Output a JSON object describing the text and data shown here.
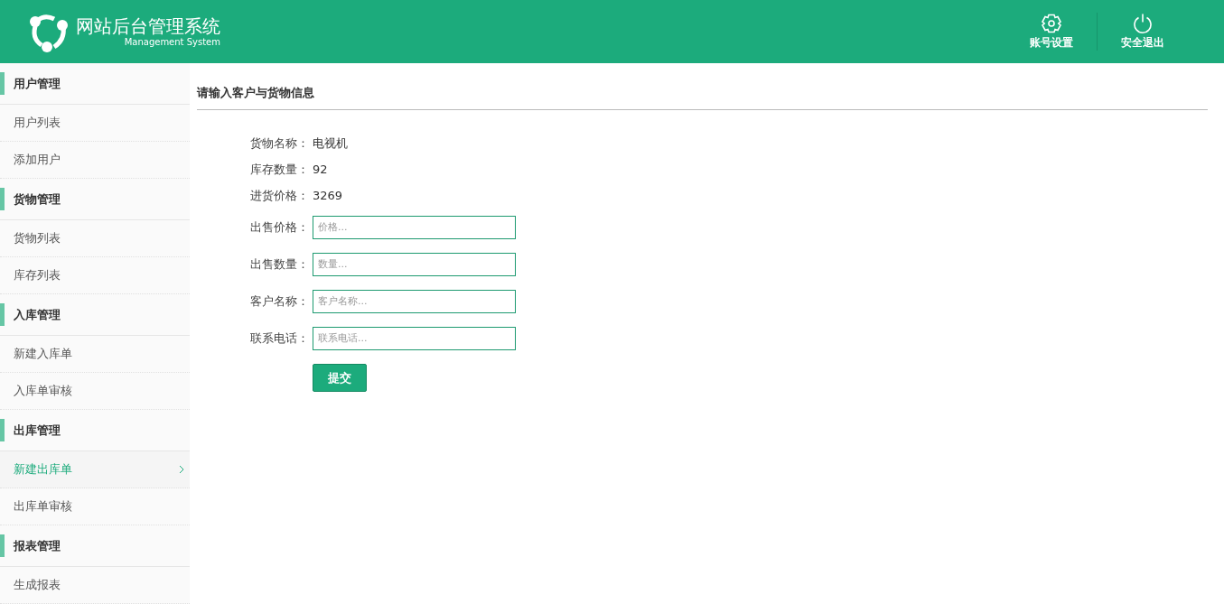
{
  "header": {
    "title": "网站后台管理系统",
    "subtitle": "Management System",
    "actions": [
      {
        "kind": "settings",
        "label": "账号设置"
      },
      {
        "kind": "power",
        "label": "安全退出"
      }
    ]
  },
  "sidebar": {
    "groups": [
      {
        "title": "用户管理",
        "items": [
          {
            "label": "用户列表",
            "selected": false
          },
          {
            "label": "添加用户",
            "selected": false
          }
        ]
      },
      {
        "title": "货物管理",
        "items": [
          {
            "label": "货物列表",
            "selected": false
          },
          {
            "label": "库存列表",
            "selected": false
          }
        ]
      },
      {
        "title": "入库管理",
        "items": [
          {
            "label": "新建入库单",
            "selected": false
          },
          {
            "label": "入库单审核",
            "selected": false
          }
        ]
      },
      {
        "title": "出库管理",
        "items": [
          {
            "label": "新建出库单",
            "selected": true
          },
          {
            "label": "出库单审核",
            "selected": false
          }
        ]
      },
      {
        "title": "报表管理",
        "items": [
          {
            "label": "生成报表",
            "selected": false
          }
        ]
      }
    ]
  },
  "form": {
    "heading": "请输入客户与货物信息",
    "info": [
      {
        "label": "货物名称：",
        "value": "电视机"
      },
      {
        "label": "库存数量：",
        "value": "92"
      },
      {
        "label": "进货价格：",
        "value": "3269"
      }
    ],
    "fields": [
      {
        "label": "出售价格：",
        "placeholder": "价格..."
      },
      {
        "label": "出售数量：",
        "placeholder": "数量..."
      },
      {
        "label": "客户名称：",
        "placeholder": "客户名称..."
      },
      {
        "label": "联系电话：",
        "placeholder": "联系电话..."
      }
    ],
    "submit": "提交"
  }
}
